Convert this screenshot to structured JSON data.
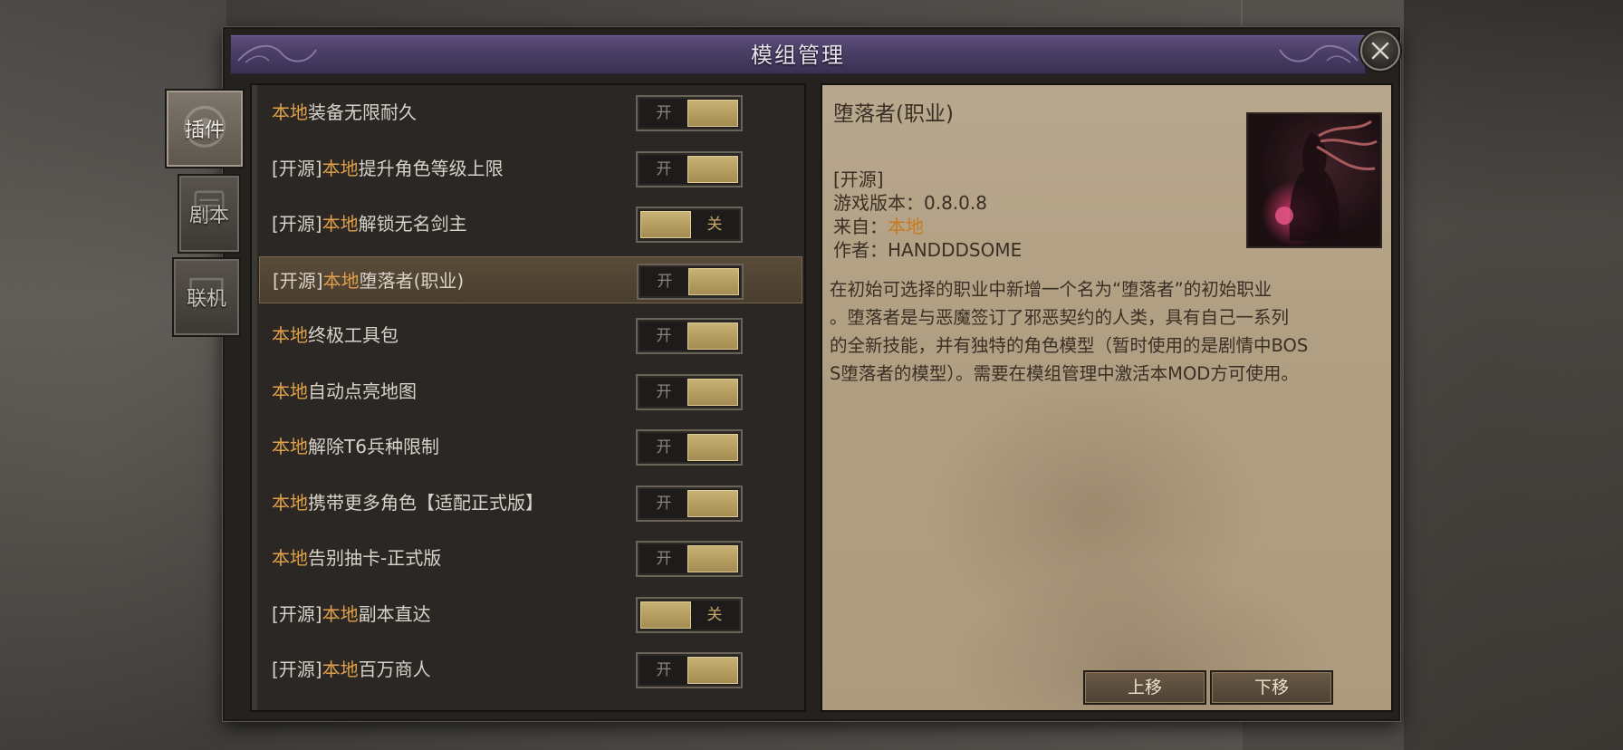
{
  "dialog": {
    "title": "模组管理"
  },
  "side_tabs": [
    {
      "label": "插件",
      "active": true
    },
    {
      "label": "剧本",
      "active": false
    },
    {
      "label": "联机",
      "active": false
    }
  ],
  "toggle_text": {
    "on": "开",
    "off": "关"
  },
  "mods": [
    {
      "tag": "",
      "source": "本地",
      "name": "装备无限耐久",
      "enabled": true,
      "selected": false
    },
    {
      "tag": "[开源]",
      "source": "本地",
      "name": "提升角色等级上限",
      "enabled": true,
      "selected": false
    },
    {
      "tag": "[开源]",
      "source": "本地",
      "name": "解锁无名剑主",
      "enabled": false,
      "selected": false
    },
    {
      "tag": "[开源]",
      "source": "本地",
      "name": "堕落者(职业)",
      "enabled": true,
      "selected": true
    },
    {
      "tag": "",
      "source": "本地",
      "name": "终极工具包",
      "enabled": true,
      "selected": false
    },
    {
      "tag": "",
      "source": "本地",
      "name": "自动点亮地图",
      "enabled": true,
      "selected": false
    },
    {
      "tag": "",
      "source": "本地",
      "name": "解除T6兵种限制",
      "enabled": true,
      "selected": false
    },
    {
      "tag": "",
      "source": "本地",
      "name": "携带更多角色【适配正式版】",
      "enabled": true,
      "selected": false
    },
    {
      "tag": "",
      "source": "本地",
      "name": "告别抽卡-正式版",
      "enabled": true,
      "selected": false
    },
    {
      "tag": "[开源]",
      "source": "本地",
      "name": "副本直达",
      "enabled": false,
      "selected": false
    },
    {
      "tag": "[开源]",
      "source": "本地",
      "name": "百万商人",
      "enabled": true,
      "selected": false
    }
  ],
  "detail": {
    "title": "堕落者(职业)",
    "tag": "[开源]",
    "version_label": "游戏版本：",
    "version": "0.8.0.8",
    "from_label": "来自：",
    "from": "本地",
    "author_label": "作者：",
    "author": "HANDDDSOME",
    "desc_lines": [
      "在初始可选择的职业中新增一个名为“堕落者”的初始职业",
      "。堕落者是与恶魔签订了邪恶契约的人类，具有自己一系列",
      "的全新技能，并有独特的角色模型（暂时使用的是剧情中BOS",
      "S堕落者的模型）。需要在模组管理中激活本MOD方可使用。"
    ]
  },
  "buttons": {
    "move_up": "上移",
    "move_down": "下移"
  }
}
